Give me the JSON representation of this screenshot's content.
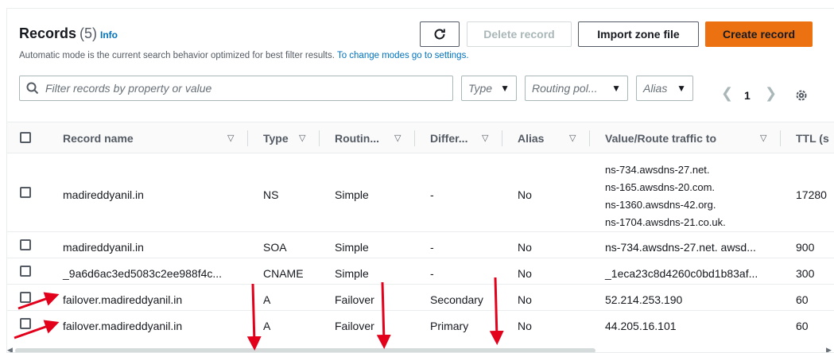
{
  "header": {
    "title": "Records",
    "count": "(5)",
    "info": "Info",
    "description": "Automatic mode is the current search behavior optimized for best filter results.",
    "description_link": "To change modes go to settings."
  },
  "toolbar": {
    "delete_label": "Delete record",
    "import_label": "Import zone file",
    "create_label": "Create record"
  },
  "filters": {
    "search_placeholder": "Filter records by property or value",
    "type_label": "Type",
    "routing_label": "Routing pol...",
    "alias_label": "Alias"
  },
  "pagination": {
    "current_page": "1"
  },
  "table": {
    "columns": [
      "Record name",
      "Type",
      "Routin...",
      "Differ...",
      "Alias",
      "Value/Route traffic to",
      "TTL (s"
    ],
    "rows": [
      {
        "name": "madireddyanil.in",
        "type": "NS",
        "routing": "Simple",
        "differ": "-",
        "alias": "No",
        "values": [
          "ns-734.awsdns-27.net.",
          "ns-165.awsdns-20.com.",
          "ns-1360.awsdns-42.org.",
          "ns-1704.awsdns-21.co.uk."
        ],
        "ttl": "17280"
      },
      {
        "name": "madireddyanil.in",
        "type": "SOA",
        "routing": "Simple",
        "differ": "-",
        "alias": "No",
        "value": "ns-734.awsdns-27.net. awsd...",
        "ttl": "900"
      },
      {
        "name": "_9a6d6ac3ed5083c2ee988f4c...",
        "type": "CNAME",
        "routing": "Simple",
        "differ": "-",
        "alias": "No",
        "value": "_1eca23c8d4260c0bd1b83af...",
        "ttl": "300"
      },
      {
        "name": "failover.madireddyanil.in",
        "type": "A",
        "routing": "Failover",
        "differ": "Secondary",
        "alias": "No",
        "value": "52.214.253.190",
        "ttl": "60"
      },
      {
        "name": "failover.madireddyanil.in",
        "type": "A",
        "routing": "Failover",
        "differ": "Primary",
        "alias": "No",
        "value": "44.205.16.101",
        "ttl": "60"
      }
    ]
  },
  "colors": {
    "accent": "#ec7211",
    "link": "#0073bb",
    "annotation": "#e3001b"
  }
}
